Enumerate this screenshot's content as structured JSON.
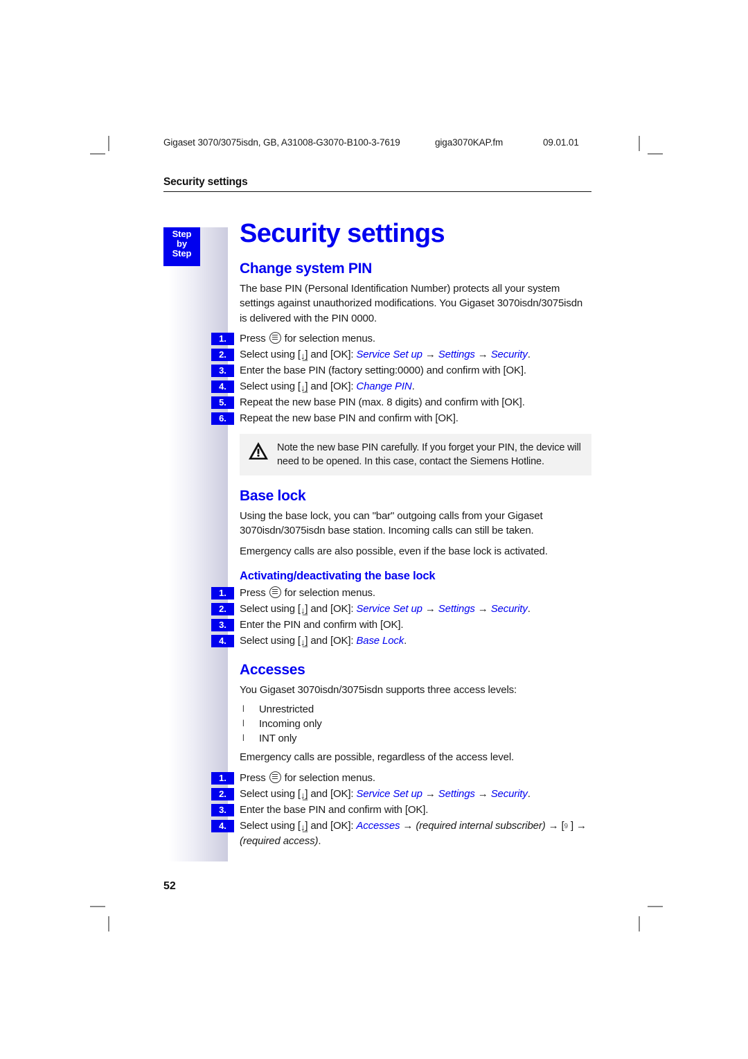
{
  "printer_header": {
    "document": "Gigaset 3070/3075isdn, GB, A31008-G3070-B100-3-7619",
    "filename": "giga3070KAP.fm",
    "date": "09.01.01"
  },
  "running_head": "Security settings",
  "step_badge": {
    "line1": "Step",
    "line2": "by",
    "line3": "Step"
  },
  "page_title": "Security settings",
  "page_number": "52",
  "sections": [
    {
      "title": "Change system PIN",
      "paragraphs": [
        "The base PIN (Personal Identification Number) protects all your system settings against unauthorized modifications. You Gigaset 3070isdn/3075isdn is delivered with the PIN 0000."
      ],
      "steps": [
        {
          "num": "1.",
          "text": "Press {menu} for selection menus."
        },
        {
          "num": "2.",
          "text": "Select using [{down}] and [OK]: {i:Service Set up} {arrow} {i:Settings} {arrow} {i:Security}."
        },
        {
          "num": "3.",
          "text": "Enter the base PIN (factory setting:0000) and confirm with [OK]."
        },
        {
          "num": "4.",
          "text": "Select using [{down}] and [OK]: {i:Change PIN}."
        },
        {
          "num": "5.",
          "text": "Repeat the new base PIN (max. 8 digits) and confirm with [OK]."
        },
        {
          "num": "6.",
          "text": "Repeat the new base PIN and confirm with [OK]."
        }
      ],
      "note": "Note the new base PIN carefully. If you forget your PIN, the device will need to be opened. In this case, contact the Siemens Hotline."
    },
    {
      "title": "Base lock",
      "paragraphs": [
        "Using the base lock, you can \"bar\" outgoing calls from your Gigaset 3070isdn/3075isdn base station. Incoming calls can still be taken.",
        "Emergency calls are also possible, even if the base lock is activated."
      ],
      "subtitle": "Activating/deactivating the base lock",
      "steps": [
        {
          "num": "1.",
          "text": "Press {menu} for selection menus."
        },
        {
          "num": "2.",
          "text": "Select using [{down}] and [OK]: {i:Service Set up} {arrow} {i:Settings} {arrow} {i:Security}."
        },
        {
          "num": "3.",
          "text": "Enter the PIN and confirm with [OK]."
        },
        {
          "num": "4.",
          "text": "Select using [{down}] and [OK]: {i:Base Lock}."
        }
      ]
    },
    {
      "title": "Accesses",
      "paragraphs": [
        "You Gigaset 3070isdn/3075isdn supports three access levels:"
      ],
      "bullets": [
        "Unrestricted",
        "Incoming only",
        "INT only"
      ],
      "paragraphs_after": [
        "Emergency calls are possible, regardless of the access level."
      ],
      "steps": [
        {
          "num": "1.",
          "text": "Press {menu} for selection menus."
        },
        {
          "num": "2.",
          "text": "Select using [{down}] and [OK]: {i:Service Set up} {arrow} {i:Settings} {arrow} {i:Security}."
        },
        {
          "num": "3.",
          "text": "Enter the base PIN and confirm with [OK]."
        },
        {
          "num": "4.",
          "text": "Select using [{down}] and [OK]: {i:Accesses} {arrow} {pi:(required internal subscriber)} {arrow} [{glyph9}  ] {arrow} {pi:(required access)}."
        }
      ]
    }
  ],
  "colors": {
    "heading_blue": "#0000f0",
    "badge_blue": "#0000ee",
    "note_bg": "#f2f2f2",
    "sidebar_end": "#ccccdf"
  },
  "glyphs": {
    "menu_key": "menu-key-icon",
    "down_key": "down-arrow-key-icon",
    "arrow": "→",
    "bullet": "l",
    "missing_glyph": "9"
  }
}
